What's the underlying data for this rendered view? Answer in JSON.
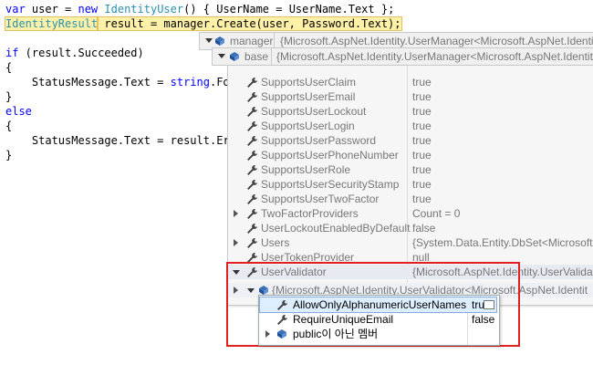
{
  "code": {
    "lines": [
      {
        "t1": "var",
        "t2": " user = ",
        "t3": "new",
        "t4": " ",
        "t5": "IdentityUser",
        "t6": "() { UserName = UserName.Text };"
      },
      {
        "t1": "IdentityResult",
        "t2": " result = manager.Create(user, Password.Text);"
      },
      {
        "t1": "if",
        "t2": " (result.Succeeded)"
      },
      {
        "t1": "{"
      },
      {
        "t1": "    StatusMessage.Text = ",
        "t2": "string",
        "t3": ".For"
      },
      {
        "t1": "}"
      },
      {
        "t1": "else"
      },
      {
        "t1": "{"
      },
      {
        "t1": "    StatusMessage.Text = result.Err"
      },
      {
        "t1": "}"
      }
    ]
  },
  "tooltip": {
    "manager_name": "manager",
    "manager_value": "{Microsoft.AspNet.Identity.UserManager<Microsoft.AspNet.Identit",
    "base_name": "base",
    "base_value": "{Microsoft.AspNet.Identity.UserManager<Microsoft.AspNet.Identity."
  },
  "properties": [
    {
      "name": "SupportsUserClaim",
      "value": "true",
      "expand": ""
    },
    {
      "name": "SupportsUserEmail",
      "value": "true",
      "expand": ""
    },
    {
      "name": "SupportsUserLockout",
      "value": "true",
      "expand": ""
    },
    {
      "name": "SupportsUserLogin",
      "value": "true",
      "expand": ""
    },
    {
      "name": "SupportsUserPassword",
      "value": "true",
      "expand": ""
    },
    {
      "name": "SupportsUserPhoneNumber",
      "value": "true",
      "expand": ""
    },
    {
      "name": "SupportsUserRole",
      "value": "true",
      "expand": ""
    },
    {
      "name": "SupportsUserSecurityStamp",
      "value": "true",
      "expand": ""
    },
    {
      "name": "SupportsUserTwoFactor",
      "value": "true",
      "expand": ""
    },
    {
      "name": "TwoFactorProviders",
      "value": "Count = 0",
      "expand": "r"
    },
    {
      "name": "UserLockoutEnabledByDefault",
      "value": "false",
      "expand": ""
    },
    {
      "name": "Users",
      "value": "{System.Data.Entity.DbSet<Microsoft.",
      "expand": "r"
    },
    {
      "name": "UserTokenProvider",
      "value": "null",
      "expand": ""
    },
    {
      "name": "UserValidator",
      "value": "{Microsoft.AspNet.Identity.UserValidat",
      "expand": "d"
    }
  ],
  "validator_child": {
    "value": "{Microsoft.AspNet.Identity.UserValidator<Microsoft.AspNet.Identit"
  },
  "submenu": [
    {
      "name": "AllowOnlyAlphanumericUserNames",
      "value": "true",
      "expand": ""
    },
    {
      "name": "RequireUniqueEmail",
      "value": "false",
      "expand": ""
    },
    {
      "name": "public이 아닌 멤버",
      "value": "",
      "expand": "r"
    }
  ],
  "colors": {
    "highlight": "#e02020",
    "keyword": "#0000ff",
    "type": "#2b91af"
  }
}
